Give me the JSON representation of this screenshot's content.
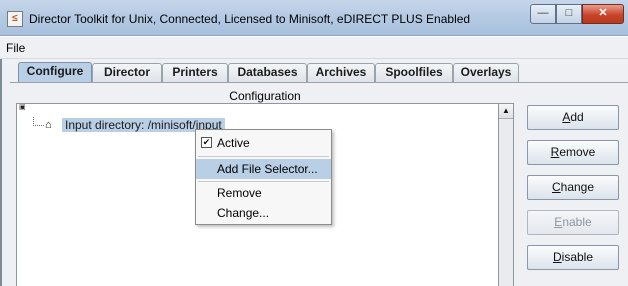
{
  "window": {
    "title": "Director Toolkit for Unix, Connected, Licensed to Minisoft, eDIRECT PLUS Enabled",
    "minimize_glyph": "—",
    "maximize_glyph": "□",
    "close_glyph": "✕",
    "app_icon_glyph": "≤"
  },
  "menu": {
    "file": "File"
  },
  "tabs": [
    {
      "label": "Configure",
      "active": true
    },
    {
      "label": "Director",
      "active": false
    },
    {
      "label": "Printers",
      "active": false
    },
    {
      "label": "Databases",
      "active": false
    },
    {
      "label": "Archives",
      "active": false
    },
    {
      "label": "Spoolfiles",
      "active": false
    },
    {
      "label": "Overlays",
      "active": false
    }
  ],
  "panel": {
    "header": "Configuration",
    "tree": {
      "root_icon": "▣",
      "node_icon": "⌂",
      "node_label": "Input directory: /minisoft/input"
    }
  },
  "context_menu": {
    "items": [
      {
        "label": "Active",
        "checked": true
      },
      {
        "label": "Add File Selector...",
        "highlighted": true
      },
      {
        "label": "Remove"
      },
      {
        "label": "Change..."
      }
    ],
    "check_glyph": "✔"
  },
  "side_buttons": [
    {
      "label": "Add",
      "mnemonic": "A",
      "rest": "dd",
      "enabled": true
    },
    {
      "label": "Remove",
      "mnemonic": "R",
      "rest": "emove",
      "enabled": true
    },
    {
      "label": "Change",
      "mnemonic": "C",
      "rest": "hange",
      "enabled": true
    },
    {
      "label": "Enable",
      "mnemonic": "E",
      "rest": "nable",
      "enabled": false
    },
    {
      "label": "Disable",
      "mnemonic": "D",
      "rest": "isable",
      "enabled": true
    }
  ],
  "scrollbar": {
    "up_glyph": "▲"
  },
  "colors": {
    "selection": "#b8cfe5",
    "title_bar": "#b5cbe4",
    "close_button": "#c8432a"
  }
}
